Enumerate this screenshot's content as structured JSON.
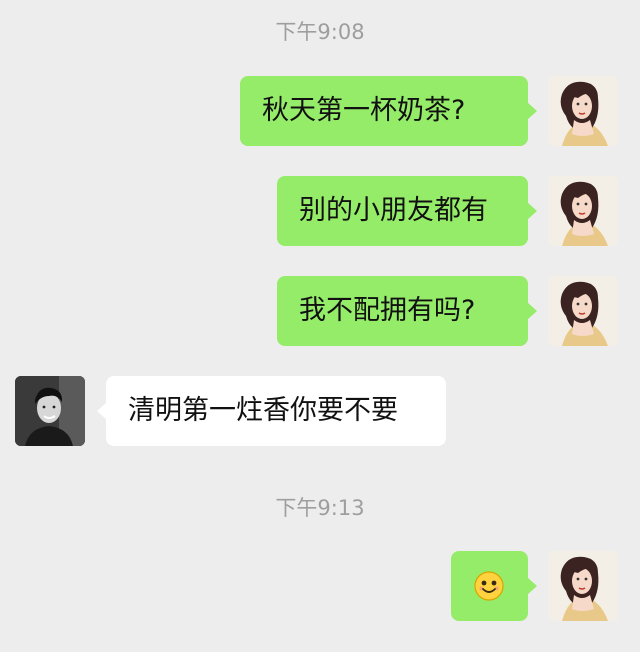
{
  "timestamps": [
    "下午9:08",
    "下午9:13"
  ],
  "messages": [
    {
      "sender": "me",
      "text": "秋天第一杯奶茶?"
    },
    {
      "sender": "me",
      "text": "别的小朋友都有"
    },
    {
      "sender": "me",
      "text": "我不配拥有吗?"
    },
    {
      "sender": "other",
      "text": "清明第一炷香你要不要"
    },
    {
      "sender": "me",
      "emoji": "smile-emoji"
    }
  ],
  "colors": {
    "background": "#ededed",
    "my_bubble": "#95ec69",
    "other_bubble": "#ffffff",
    "timestamp": "#9e9e9e"
  }
}
